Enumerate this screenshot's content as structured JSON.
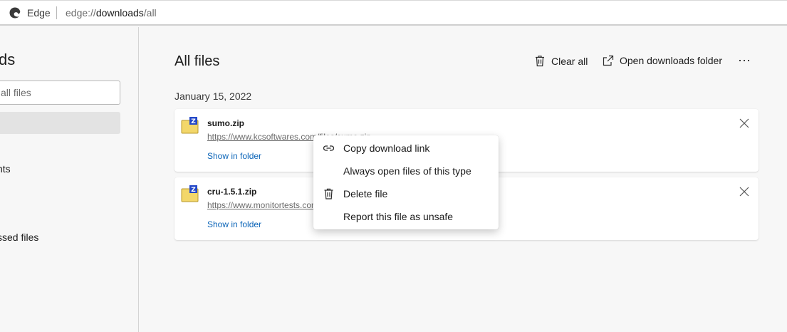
{
  "browser": {
    "name": "Edge",
    "url_scheme": "edge://",
    "url_host": "downloads",
    "url_path": "/all"
  },
  "sidebar": {
    "title": "ds",
    "search_placeholder": "all files",
    "items": [
      {
        "label": "nts"
      },
      {
        "label": "ssed files"
      }
    ]
  },
  "main": {
    "title": "All files",
    "clear_all_label": "Clear all",
    "open_folder_label": "Open downloads folder",
    "more_label": "···",
    "date_group": "January 15, 2022"
  },
  "downloads": [
    {
      "name": "sumo.zip",
      "url": "https://www.kcsoftwares.com/files/sumo.zip",
      "action_label": "Show in folder"
    },
    {
      "name": "cru-1.5.1.zip",
      "url": "https://www.monitortests.com/download/cru/cru-1.5.1.zip",
      "action_label": "Show in folder"
    }
  ],
  "context_menu": {
    "items": [
      {
        "label": "Copy download link",
        "icon": "link-icon"
      },
      {
        "label": "Always open files of this type",
        "icon": ""
      },
      {
        "label": "Delete file",
        "icon": "trash-icon"
      },
      {
        "label": "Report this file as unsafe",
        "icon": ""
      }
    ]
  },
  "colors": {
    "link": "#0a64b8",
    "background": "#f7f7f7",
    "card": "#ffffff"
  }
}
